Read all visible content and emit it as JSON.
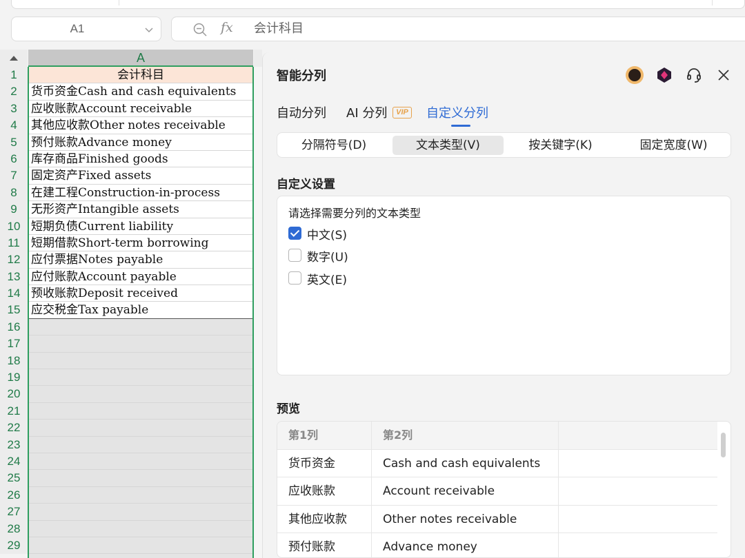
{
  "formula_bar": {
    "cell_ref": "A1",
    "fx_label": "fx",
    "content": "会计科目"
  },
  "grid": {
    "column_header": "A",
    "row_numbers": [
      "1",
      "2",
      "3",
      "4",
      "5",
      "6",
      "7",
      "8",
      "9",
      "10",
      "11",
      "12",
      "13",
      "14",
      "15",
      "16",
      "17",
      "18",
      "19",
      "20",
      "21",
      "22",
      "23",
      "24",
      "25",
      "26",
      "27",
      "28",
      "29"
    ],
    "header_cell": "会计科目",
    "data_cells": [
      "货币资金Cash and cash equivalents",
      "应收账款Account receivable",
      "其他应收款Other notes receivable",
      "预付账款Advance money",
      "库存商品Finished goods",
      "固定资产Fixed assets",
      "在建工程Construction-in-process",
      "无形资产Intangible assets",
      "短期负债Current liability",
      "短期借款Short-term borrowing",
      "应付票据Notes payable",
      "应付账款Account payable",
      "预收账款Deposit received",
      "应交税金Tax payable"
    ]
  },
  "panel": {
    "title": "智能分列",
    "icons": [
      "avatar",
      "gem-icon",
      "headset-icon",
      "close-icon"
    ],
    "tabs": [
      "自动分列",
      "AI 分列",
      "自定义分列"
    ],
    "vip_badge": "VIP",
    "active_tab": "自定义分列",
    "segments": [
      "分隔符号(D)",
      "文本类型(V)",
      "按关键字(K)",
      "固定宽度(W)"
    ],
    "active_segment": "文本类型(V)",
    "settings_title": "自定义设置",
    "settings_prompt": "请选择需要分列的文本类型",
    "options": [
      {
        "label": "中文(S)",
        "checked": true
      },
      {
        "label": "数字(U)",
        "checked": false
      },
      {
        "label": "英文(E)",
        "checked": false
      }
    ],
    "preview_title": "预览",
    "preview_headers": [
      "第1列",
      "第2列"
    ],
    "preview_rows": [
      [
        "货币资金",
        "Cash and cash equivalents"
      ],
      [
        "应收账款",
        "Account receivable"
      ],
      [
        "其他应收款",
        "Other notes receivable"
      ],
      [
        "预付账款",
        "Advance money"
      ]
    ]
  },
  "colors": {
    "accent": "#2f6bd4",
    "selection_green": "#2e9e5f",
    "header_fill": "#fce5d7",
    "vip": "#e7a24b"
  }
}
